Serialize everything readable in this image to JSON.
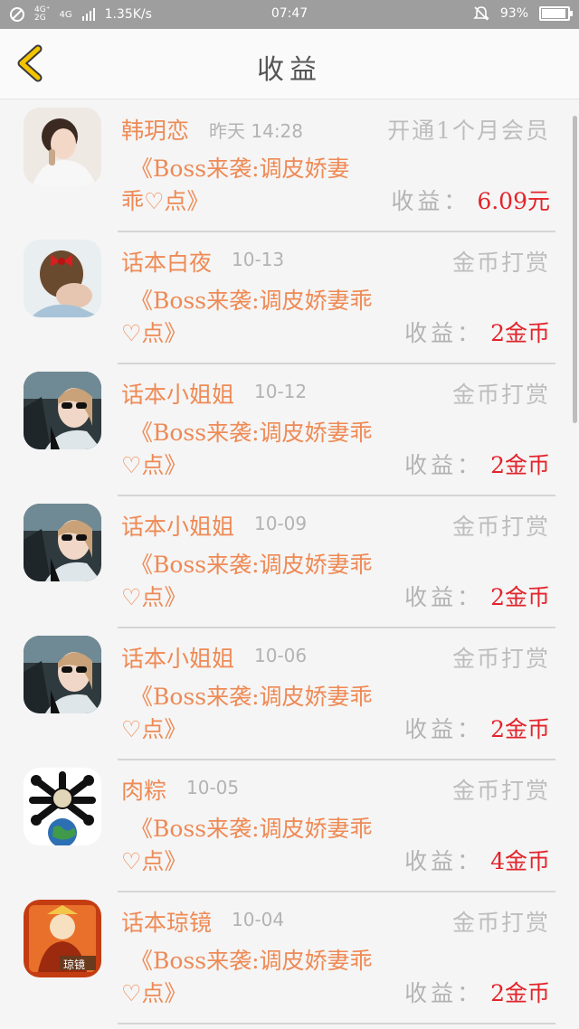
{
  "status_bar": {
    "network_labels": [
      "4G⁺",
      "4G",
      "2G"
    ],
    "speed": "1.35K/s",
    "time": "07:47",
    "battery": "93%",
    "battery_level": 0.93
  },
  "header": {
    "title": "收益"
  },
  "colors": {
    "accent_orange": "#ee8a55",
    "earning_red": "#e3242b",
    "muted_gray": "#b3b3b3"
  },
  "items": [
    {
      "name": "韩玥恋",
      "date": "昨天 14:28",
      "type": "开通1个月会员",
      "book_line1": "《Boss来袭:调皮娇妻",
      "book_line2": "乖♡点》",
      "earning_label": "收益：",
      "earning_value": "6.09元",
      "avatar_icon": "woman-portrait-avatar"
    },
    {
      "name": "话本白夜",
      "date": "10-13",
      "type": "金币打赏",
      "book_line1": "《Boss来袭:调皮娇妻乖",
      "book_line2": "♡点》",
      "earning_label": "收益：",
      "earning_value": "2金币",
      "avatar_icon": "woman-red-bow-avatar"
    },
    {
      "name": "话本小姐姐",
      "date": "10-12",
      "type": "金币打赏",
      "book_line1": "《Boss来袭:调皮娇妻乖",
      "book_line2": "♡点》",
      "earning_label": "收益：",
      "earning_value": "2金币",
      "avatar_icon": "woman-sunglasses-avatar"
    },
    {
      "name": "话本小姐姐",
      "date": "10-09",
      "type": "金币打赏",
      "book_line1": "《Boss来袭:调皮娇妻乖",
      "book_line2": "♡点》",
      "earning_label": "收益：",
      "earning_value": "2金币",
      "avatar_icon": "woman-sunglasses-avatar"
    },
    {
      "name": "话本小姐姐",
      "date": "10-06",
      "type": "金币打赏",
      "book_line1": "《Boss来袭:调皮娇妻乖",
      "book_line2": "♡点》",
      "earning_label": "收益：",
      "earning_value": "2金币",
      "avatar_icon": "woman-sunglasses-avatar"
    },
    {
      "name": "肉粽",
      "date": "10-05",
      "type": "金币打赏",
      "book_line1": "《Boss来袭:调皮娇妻乖",
      "book_line2": "♡点》",
      "earning_label": "收益：",
      "earning_value": "4金币",
      "avatar_icon": "crossbones-globe-avatar"
    },
    {
      "name": "话本琼镜",
      "date": "10-04",
      "type": "金币打赏",
      "book_line1": "《Boss来袭:调皮娇妻乖",
      "book_line2": "♡点》",
      "earning_label": "收益：",
      "earning_value": "2金币",
      "avatar_icon": "orange-poster-avatar",
      "avatar_text": "琼镜"
    }
  ]
}
